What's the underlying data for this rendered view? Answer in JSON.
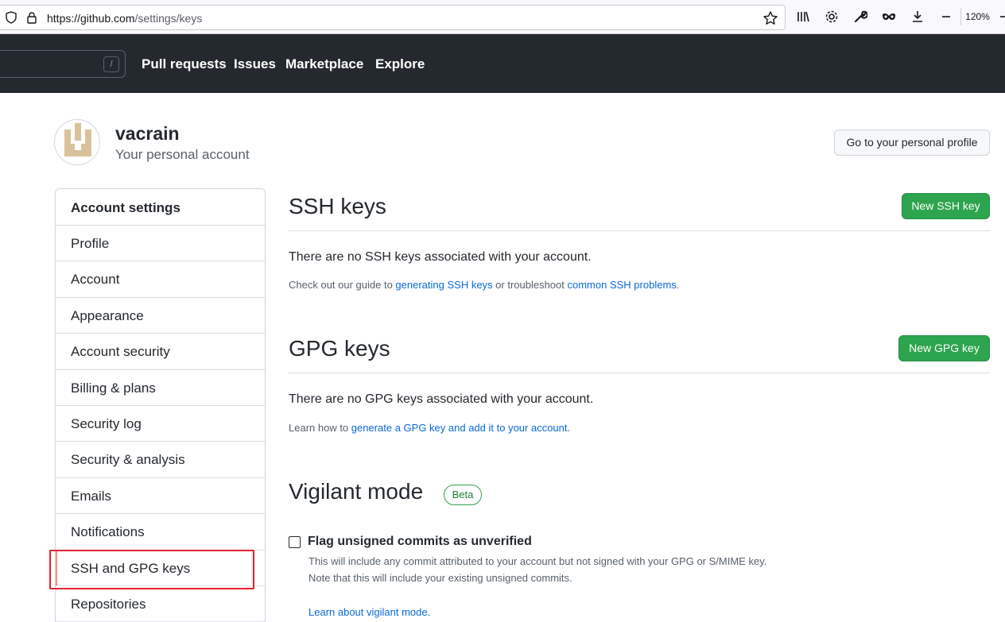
{
  "browser": {
    "url_main": "https://github.com",
    "url_path": "/settings/keys",
    "zoom": "120%",
    "icons": [
      "shield-icon",
      "lock-icon",
      "bookmark-star-icon",
      "library-icon",
      "gear-icon",
      "wrench-icon",
      "mask-icon",
      "download-icon",
      "minus-icon"
    ]
  },
  "gh_header": {
    "search_shortcut": "/",
    "nav": [
      "Pull requests",
      "Issues",
      "Marketplace",
      "Explore"
    ]
  },
  "profile": {
    "username": "vacrain",
    "subtitle": "Your personal account",
    "profile_button": "Go to your personal profile"
  },
  "sidebar": {
    "heading": "Account settings",
    "items": [
      {
        "label": "Profile"
      },
      {
        "label": "Account"
      },
      {
        "label": "Appearance"
      },
      {
        "label": "Account security"
      },
      {
        "label": "Billing & plans"
      },
      {
        "label": "Security log"
      },
      {
        "label": "Security & analysis"
      },
      {
        "label": "Emails"
      },
      {
        "label": "Notifications"
      },
      {
        "label": "SSH and GPG keys",
        "selected": true
      },
      {
        "label": "Repositories"
      }
    ]
  },
  "ssh": {
    "title": "SSH keys",
    "button": "New SSH key",
    "empty": "There are no SSH keys associated with your account.",
    "note_prefix": "Check out our guide to ",
    "note_link1": "generating SSH keys",
    "note_middle": " or troubleshoot ",
    "note_link2": "common SSH problems",
    "note_suffix": "."
  },
  "gpg": {
    "title": "GPG keys",
    "button": "New GPG key",
    "empty": "There are no GPG keys associated with your account.",
    "note_prefix": "Learn how to ",
    "note_link": "generate a GPG key and add it to your account",
    "note_suffix": "."
  },
  "vigilant": {
    "title": "Vigilant mode",
    "badge": "Beta",
    "checkbox_label": "Flag unsigned commits as unverified",
    "checked": false,
    "desc_line1": "This will include any commit attributed to your account but not signed with your GPG or S/MIME key.",
    "desc_line2": "Note that this will include your existing unsigned commits.",
    "learn_link": "Learn about vigilant mode."
  },
  "colors": {
    "header_bg": "#24292f",
    "primary_green": "#2da44e",
    "link_blue": "#0969da",
    "highlight_red": "#e8212e",
    "selected_marker": "#fd8c73"
  }
}
